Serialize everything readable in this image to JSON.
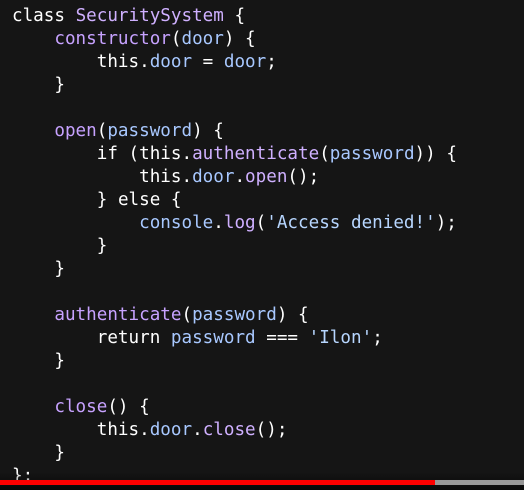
{
  "code": {
    "lines": [
      [
        {
          "t": "class ",
          "c": "kw"
        },
        {
          "t": "SecuritySystem",
          "c": "class"
        },
        {
          "t": " {",
          "c": "punc"
        }
      ],
      [
        {
          "t": "    ",
          "c": "plain"
        },
        {
          "t": "constructor",
          "c": "fn"
        },
        {
          "t": "(",
          "c": "punc"
        },
        {
          "t": "door",
          "c": "param"
        },
        {
          "t": ") {",
          "c": "punc"
        }
      ],
      [
        {
          "t": "        ",
          "c": "plain"
        },
        {
          "t": "this",
          "c": "this"
        },
        {
          "t": ".",
          "c": "punc"
        },
        {
          "t": "door",
          "c": "prop"
        },
        {
          "t": " = ",
          "c": "punc"
        },
        {
          "t": "door",
          "c": "param"
        },
        {
          "t": ";",
          "c": "punc"
        }
      ],
      [
        {
          "t": "    }",
          "c": "punc"
        }
      ],
      [
        {
          "t": "",
          "c": "plain"
        }
      ],
      [
        {
          "t": "    ",
          "c": "plain"
        },
        {
          "t": "open",
          "c": "fn"
        },
        {
          "t": "(",
          "c": "punc"
        },
        {
          "t": "password",
          "c": "param"
        },
        {
          "t": ") {",
          "c": "punc"
        }
      ],
      [
        {
          "t": "        ",
          "c": "plain"
        },
        {
          "t": "if",
          "c": "kw"
        },
        {
          "t": " (",
          "c": "punc"
        },
        {
          "t": "this",
          "c": "this"
        },
        {
          "t": ".",
          "c": "punc"
        },
        {
          "t": "authenticate",
          "c": "method"
        },
        {
          "t": "(",
          "c": "punc"
        },
        {
          "t": "password",
          "c": "param"
        },
        {
          "t": ")) {",
          "c": "punc"
        }
      ],
      [
        {
          "t": "            ",
          "c": "plain"
        },
        {
          "t": "this",
          "c": "this"
        },
        {
          "t": ".",
          "c": "punc"
        },
        {
          "t": "door",
          "c": "prop"
        },
        {
          "t": ".",
          "c": "punc"
        },
        {
          "t": "open",
          "c": "method"
        },
        {
          "t": "();",
          "c": "punc"
        }
      ],
      [
        {
          "t": "        } ",
          "c": "punc"
        },
        {
          "t": "else",
          "c": "kw"
        },
        {
          "t": " {",
          "c": "punc"
        }
      ],
      [
        {
          "t": "            ",
          "c": "plain"
        },
        {
          "t": "console",
          "c": "prop"
        },
        {
          "t": ".",
          "c": "punc"
        },
        {
          "t": "log",
          "c": "method"
        },
        {
          "t": "(",
          "c": "punc"
        },
        {
          "t": "'Access denied!'",
          "c": "str"
        },
        {
          "t": ");",
          "c": "punc"
        }
      ],
      [
        {
          "t": "        }",
          "c": "punc"
        }
      ],
      [
        {
          "t": "    }",
          "c": "punc"
        }
      ],
      [
        {
          "t": "",
          "c": "plain"
        }
      ],
      [
        {
          "t": "    ",
          "c": "plain"
        },
        {
          "t": "authenticate",
          "c": "fn"
        },
        {
          "t": "(",
          "c": "punc"
        },
        {
          "t": "password",
          "c": "param"
        },
        {
          "t": ") {",
          "c": "punc"
        }
      ],
      [
        {
          "t": "        ",
          "c": "plain"
        },
        {
          "t": "return",
          "c": "kw"
        },
        {
          "t": " ",
          "c": "plain"
        },
        {
          "t": "password",
          "c": "param"
        },
        {
          "t": " === ",
          "c": "punc"
        },
        {
          "t": "'Ilon'",
          "c": "str"
        },
        {
          "t": ";",
          "c": "punc"
        }
      ],
      [
        {
          "t": "    }",
          "c": "punc"
        }
      ],
      [
        {
          "t": "",
          "c": "plain"
        }
      ],
      [
        {
          "t": "    ",
          "c": "plain"
        },
        {
          "t": "close",
          "c": "fn"
        },
        {
          "t": "() {",
          "c": "punc"
        }
      ],
      [
        {
          "t": "        ",
          "c": "plain"
        },
        {
          "t": "this",
          "c": "this"
        },
        {
          "t": ".",
          "c": "punc"
        },
        {
          "t": "door",
          "c": "prop"
        },
        {
          "t": ".",
          "c": "punc"
        },
        {
          "t": "close",
          "c": "method"
        },
        {
          "t": "();",
          "c": "punc"
        }
      ],
      [
        {
          "t": "    }",
          "c": "punc"
        }
      ],
      [
        {
          "t": "};",
          "c": "punc"
        }
      ]
    ]
  },
  "video_player": {
    "progress_fraction": 0.83,
    "buffered_fraction": 1.0,
    "progress_color": "#ff0000"
  },
  "colors": {
    "background": "#151515",
    "keyword": "#ffffff",
    "class_name": "#cfb0ff",
    "function_name": "#c7a2ff",
    "parameter": "#a8c8ff",
    "string": "#b7d6ff"
  }
}
